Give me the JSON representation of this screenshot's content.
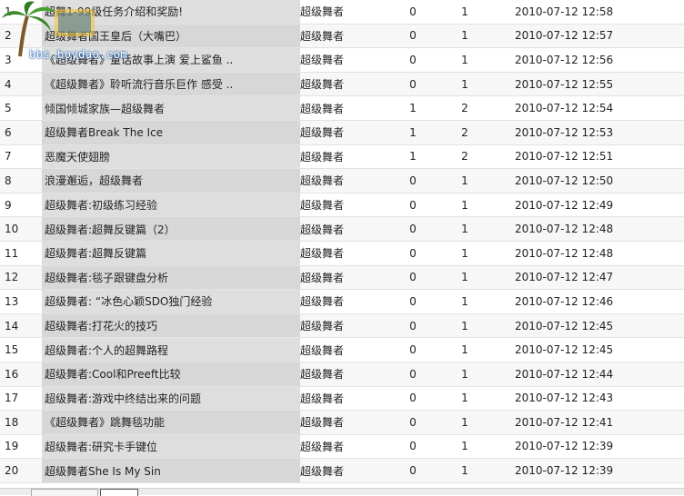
{
  "watermark": {
    "text": "bbs.boydao.com"
  },
  "rows": [
    {
      "idx": "1",
      "title": "超舞1-99级任务介绍和奖励!",
      "category": "超级舞者",
      "a": "0",
      "b": "1",
      "date": "2010-07-12 12:58"
    },
    {
      "idx": "2",
      "title": "超级舞者国王皇后（大嘴巴）",
      "category": "超级舞者",
      "a": "0",
      "b": "1",
      "date": "2010-07-12 12:57"
    },
    {
      "idx": "3",
      "title": "《超级舞者》童话故事上演 爱上鲨鱼 ..",
      "category": "超级舞者",
      "a": "0",
      "b": "1",
      "date": "2010-07-12 12:56"
    },
    {
      "idx": "4",
      "title": "《超级舞者》聆听流行音乐巨作 感受 ..",
      "category": "超级舞者",
      "a": "0",
      "b": "1",
      "date": "2010-07-12 12:55"
    },
    {
      "idx": "5",
      "title": "倾国倾城家族—超级舞者",
      "category": "超级舞者",
      "a": "1",
      "b": "2",
      "date": "2010-07-12 12:54"
    },
    {
      "idx": "6",
      "title": "超级舞者Break The Ice",
      "category": "超级舞者",
      "a": "1",
      "b": "2",
      "date": "2010-07-12 12:53"
    },
    {
      "idx": "7",
      "title": "恶魔天使翅膀",
      "category": "超级舞者",
      "a": "1",
      "b": "2",
      "date": "2010-07-12 12:51"
    },
    {
      "idx": "8",
      "title": "浪漫邂逅，超级舞者",
      "category": "超级舞者",
      "a": "0",
      "b": "1",
      "date": "2010-07-12 12:50"
    },
    {
      "idx": "9",
      "title": "超级舞者:初级练习经验",
      "category": "超级舞者",
      "a": "0",
      "b": "1",
      "date": "2010-07-12 12:49"
    },
    {
      "idx": "10",
      "title": "超级舞者:超舞反键篇（2）",
      "category": "超级舞者",
      "a": "0",
      "b": "1",
      "date": "2010-07-12 12:48"
    },
    {
      "idx": "11",
      "title": "超级舞者:超舞反键篇",
      "category": "超级舞者",
      "a": "0",
      "b": "1",
      "date": "2010-07-12 12:48"
    },
    {
      "idx": "12",
      "title": "超级舞者:毯子跟键盘分析",
      "category": "超级舞者",
      "a": "0",
      "b": "1",
      "date": "2010-07-12 12:47"
    },
    {
      "idx": "13",
      "title": "超级舞者: “冰色心颖SDO独门经验",
      "category": "超级舞者",
      "a": "0",
      "b": "1",
      "date": "2010-07-12 12:46"
    },
    {
      "idx": "14",
      "title": "超级舞者:打花火的技巧",
      "category": "超级舞者",
      "a": "0",
      "b": "1",
      "date": "2010-07-12 12:45"
    },
    {
      "idx": "15",
      "title": "超级舞者:个人的超舞路程",
      "category": "超级舞者",
      "a": "0",
      "b": "1",
      "date": "2010-07-12 12:45"
    },
    {
      "idx": "16",
      "title": "超级舞者:Cool和Preeft比较",
      "category": "超级舞者",
      "a": "0",
      "b": "1",
      "date": "2010-07-12 12:44"
    },
    {
      "idx": "17",
      "title": "超级舞者:游戏中终结出来的问题",
      "category": "超级舞者",
      "a": "0",
      "b": "1",
      "date": "2010-07-12 12:43"
    },
    {
      "idx": "18",
      "title": "《超级舞者》跳舞毯功能",
      "category": "超级舞者",
      "a": "0",
      "b": "1",
      "date": "2010-07-12 12:41"
    },
    {
      "idx": "19",
      "title": "超级舞者:研究卡手键位",
      "category": "超级舞者",
      "a": "0",
      "b": "1",
      "date": "2010-07-12 12:39"
    },
    {
      "idx": "20",
      "title": "超级舞者She Is My Sin",
      "category": "超级舞者",
      "a": "0",
      "b": "1",
      "date": "2010-07-12 12:39"
    }
  ]
}
